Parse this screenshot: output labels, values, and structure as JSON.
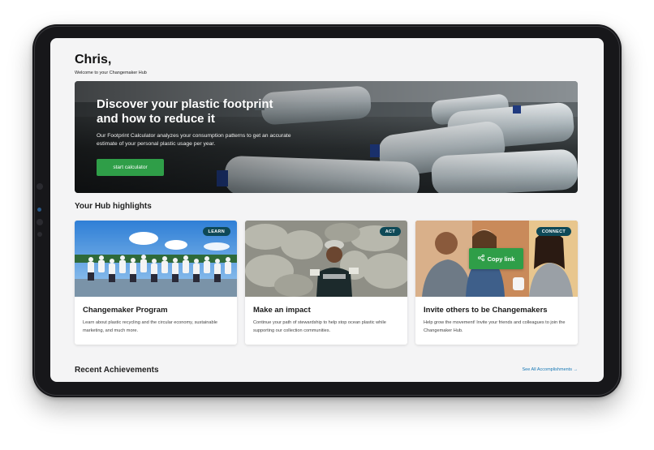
{
  "user": {
    "greeting": "Chris,",
    "welcome": "Welcome to your Changemaker Hub"
  },
  "hero": {
    "title": "Discover your plastic footprint and how to reduce it",
    "description": "Our Footprint Calculator analyzes your consumption patterns to get an accurate estimate of your personal plastic usage per year.",
    "button_label": "start calculator"
  },
  "highlights": {
    "title": "Your Hub highlights",
    "cards": [
      {
        "tag": "LEARN",
        "title": "Changemaker Program",
        "description": "Learn about plastic recycling and the circular economy, sustainable marketing, and much more."
      },
      {
        "tag": "ACT",
        "title": "Make an impact",
        "description": "Continue your path of stewardship to help stop ocean plastic while supporting our collection communities."
      },
      {
        "tag": "CONNECT",
        "title": "Invite others to be Changemakers",
        "description": "Help grow the movement! Invite your friends and colleagues to join the Changemaker Hub.",
        "copy_label": "Copy link"
      }
    ]
  },
  "recent": {
    "title": "Recent Achievements",
    "link_label": "See All Accomplishments →"
  },
  "colors": {
    "accent_green": "#2f9e48",
    "tag_teal": "#0e4957",
    "link_blue": "#1778b5"
  }
}
